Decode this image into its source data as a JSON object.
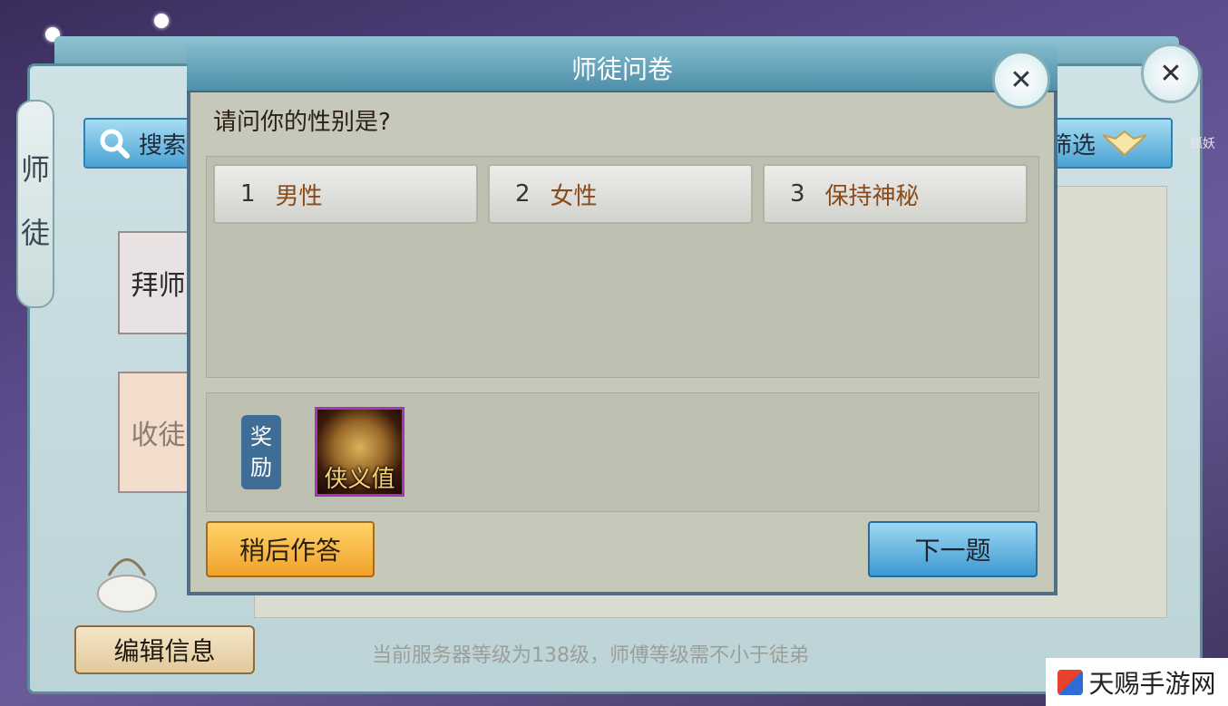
{
  "background": {
    "side_tab_chars": [
      "师",
      "徒"
    ],
    "search_label": "搜索",
    "filter_label": "筛选",
    "lantern_1": "拜师",
    "lantern_2": "收徒",
    "edit_info": "编辑信息",
    "server_note": "当前服务器等级为138级，师傅等级需不小于徒弟",
    "fox_label": "狐妖"
  },
  "dialog": {
    "title": "师徒问卷",
    "question": "请问你的性别是?",
    "options": [
      {
        "num": "1",
        "label": "男性"
      },
      {
        "num": "2",
        "label": "女性"
      },
      {
        "num": "3",
        "label": "保持神秘"
      }
    ],
    "reward_tag": [
      "奖",
      "励"
    ],
    "reward_item_label": "侠义值",
    "later_button": "稍后作答",
    "next_button": "下一题"
  },
  "watermark": "天赐手游网",
  "icons": {
    "search": "search-icon",
    "close": "close-icon",
    "filter": "filter-icon",
    "teapot": "teapot-icon",
    "reward_item": "xiayi-reward-icon"
  },
  "colors": {
    "dialog_header": "#5f9fb6",
    "option_label": "#8a4a1a",
    "later_button": "#f5b73f",
    "next_button": "#52a8d9"
  }
}
